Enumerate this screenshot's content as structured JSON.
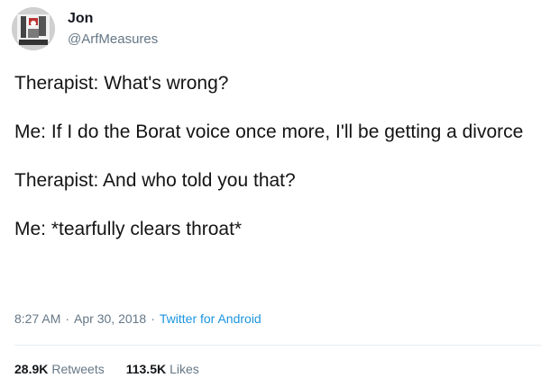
{
  "user": {
    "display_name": "Jon",
    "handle": "@ArfMeasures"
  },
  "tweet": {
    "paragraphs": [
      "Therapist: What's wrong?",
      "Me: If I do the Borat voice once more, I'll be getting a divorce",
      "Therapist: And who told you that?",
      "Me: *tearfully clears throat*"
    ],
    "time": "8:27 AM",
    "date": "Apr 30, 2018",
    "separator": "·",
    "source": "Twitter for Android"
  },
  "stats": {
    "retweets_count": "28.9K",
    "retweets_label": "Retweets",
    "likes_count": "113.5K",
    "likes_label": "Likes"
  },
  "colors": {
    "link": "#1b95e0",
    "muted": "#657786",
    "text": "#141414"
  },
  "icons": {
    "avatar": "profile-photo"
  }
}
